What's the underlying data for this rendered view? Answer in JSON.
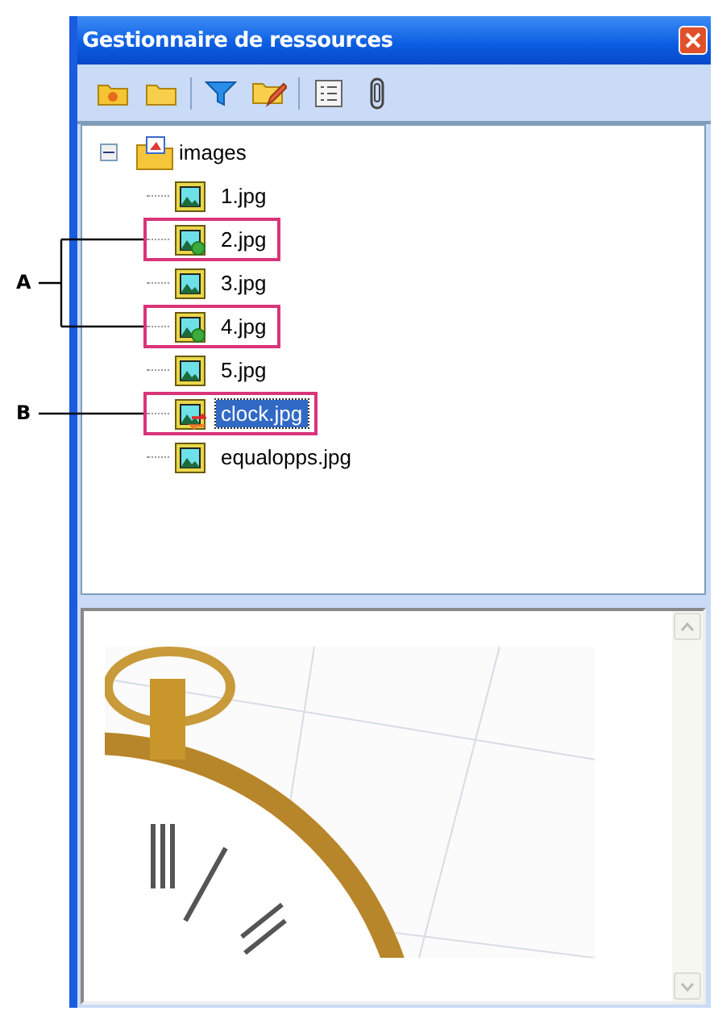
{
  "window": {
    "title": "Gestionnaire de ressources"
  },
  "toolbar": {
    "groups": [
      {
        "buttons": [
          {
            "kind": "folder-sun"
          },
          {
            "kind": "folder"
          }
        ]
      },
      {
        "buttons": [
          {
            "kind": "filter"
          },
          {
            "kind": "folder-edit"
          }
        ]
      },
      {
        "buttons": [
          {
            "kind": "list"
          },
          {
            "kind": "paperclip"
          }
        ]
      }
    ]
  },
  "tree": {
    "label": "images",
    "expanded": true,
    "children": [
      {
        "label": "1.jpg",
        "kind": "normal",
        "selected": false,
        "highlighted": false
      },
      {
        "label": "2.jpg",
        "kind": "synced",
        "selected": false,
        "highlighted": true
      },
      {
        "label": "3.jpg",
        "kind": "normal",
        "selected": false,
        "highlighted": false
      },
      {
        "label": "4.jpg",
        "kind": "synced",
        "selected": false,
        "highlighted": true
      },
      {
        "label": "5.jpg",
        "kind": "normal",
        "selected": false,
        "highlighted": false
      },
      {
        "label": "clock.jpg",
        "kind": "conflict",
        "selected": true,
        "highlighted": true
      },
      {
        "label": "equalopps.jpg",
        "kind": "normal",
        "selected": false,
        "highlighted": false
      }
    ]
  },
  "callouts": [
    {
      "kind": "bracket",
      "label": "A"
    },
    {
      "kind": "single",
      "label": "B"
    }
  ],
  "preview": {
    "kind": "photo"
  }
}
